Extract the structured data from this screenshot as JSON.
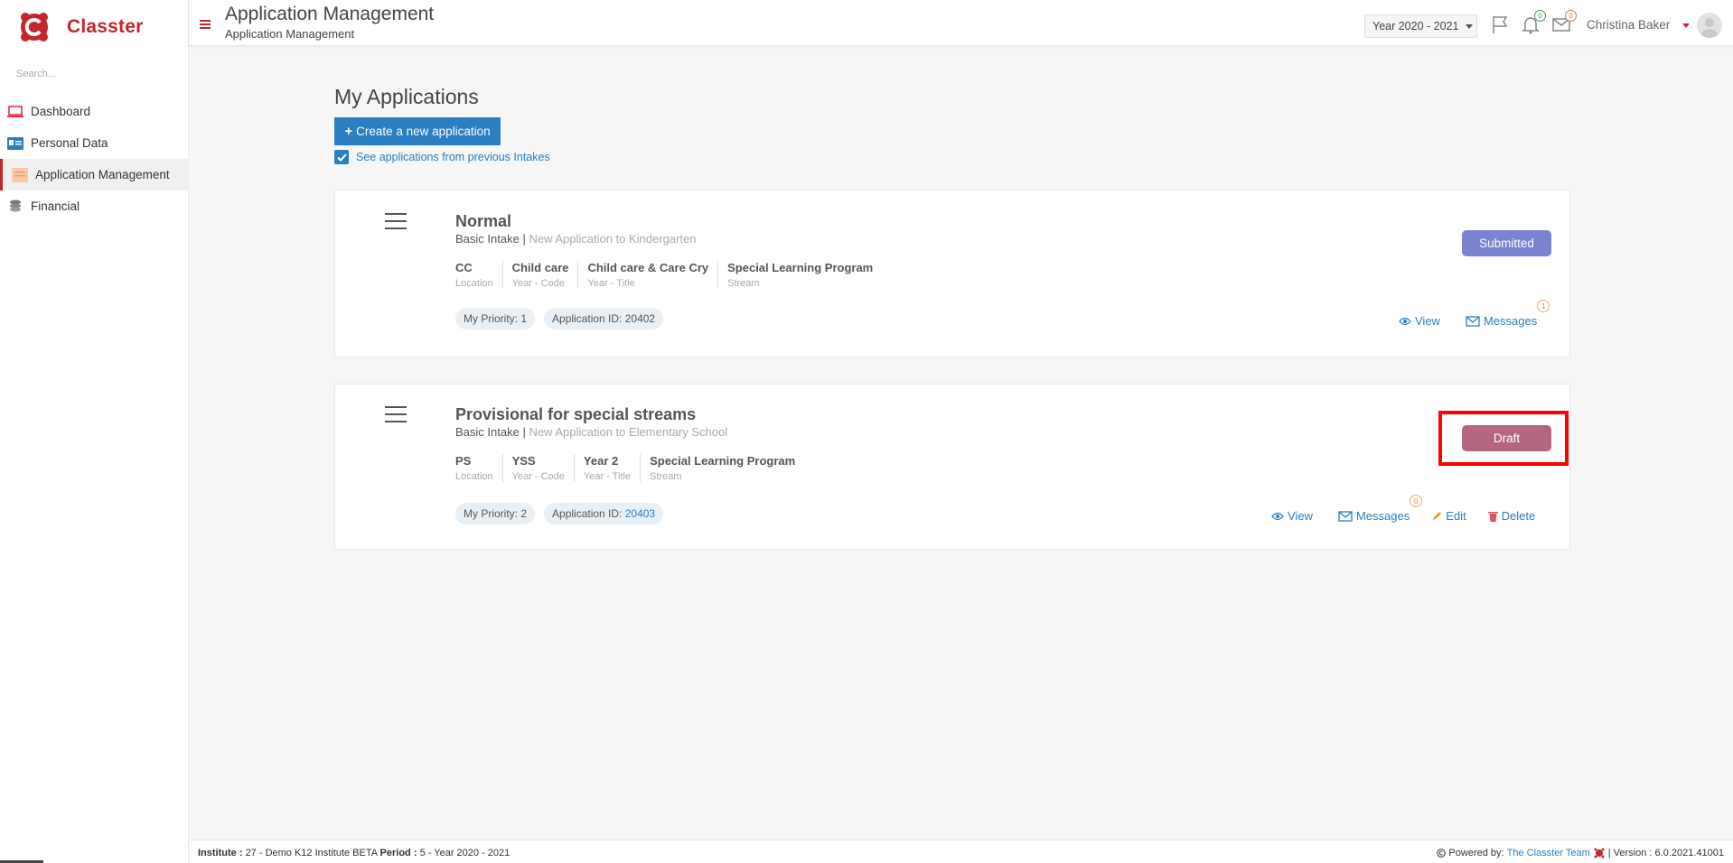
{
  "app": {
    "name": "Classter"
  },
  "sidebar": {
    "search_placeholder": "Search...",
    "items": [
      {
        "label": "Dashboard",
        "icon": "laptop-icon"
      },
      {
        "label": "Personal Data",
        "icon": "id-card-icon"
      },
      {
        "label": "Application Management",
        "icon": "form-icon"
      },
      {
        "label": "Financial",
        "icon": "coins-icon"
      }
    ]
  },
  "header": {
    "title": "Application Management",
    "subtitle": "Application Management",
    "year_select": "Year 2020 - 2021",
    "notifications_count": "0",
    "messages_count": "0",
    "user_name": "Christina Baker"
  },
  "main": {
    "title": "My Applications",
    "create_button": "Create a new application",
    "previous_intakes_label": "See applications from previous Intakes",
    "previous_intakes_checked": true
  },
  "applications": [
    {
      "title": "Normal",
      "intake": "Basic Intake",
      "description": "New Application to Kindergarten",
      "fields": [
        {
          "value": "CC",
          "label": "Location"
        },
        {
          "value": "Child care",
          "label": "Year - Code"
        },
        {
          "value": "Child care & Care Cry",
          "label": "Year - Title"
        },
        {
          "value": "Special Learning Program",
          "label": "Stream"
        }
      ],
      "priority": "My Priority: 1",
      "app_id_label": "Application ID:",
      "app_id": "20402",
      "status": "Submitted",
      "status_color": "#7b82cf",
      "actions": {
        "view": "View",
        "messages": "Messages",
        "messages_count": "1"
      }
    },
    {
      "title": "Provisional for special streams",
      "intake": "Basic Intake",
      "description": "New Application to Elementary School",
      "fields": [
        {
          "value": "PS",
          "label": "Location"
        },
        {
          "value": "YSS",
          "label": "Year - Code"
        },
        {
          "value": "Year 2",
          "label": "Year - Title"
        },
        {
          "value": "Special Learning Program",
          "label": "Stream"
        }
      ],
      "priority": "My Priority: 2",
      "app_id_label": "Application ID:",
      "app_id": "20403",
      "status": "Draft",
      "status_color": "#b5667f",
      "actions": {
        "view": "View",
        "messages": "Messages",
        "messages_count": "0",
        "edit": "Edit",
        "delete": "Delete"
      }
    }
  ],
  "footer": {
    "institute_label": "Institute :",
    "institute_value": "27 - Demo K12 Institute BETA",
    "period_label": "Period :",
    "period_value": "5 - Year 2020 - 2021",
    "powered_label": "Powered by:",
    "powered_link": "The Classter Team",
    "version": "| Version : 6.0.2021.41001"
  },
  "colors": {
    "brand": "#c1272d",
    "accent": "#2b7ec1"
  }
}
